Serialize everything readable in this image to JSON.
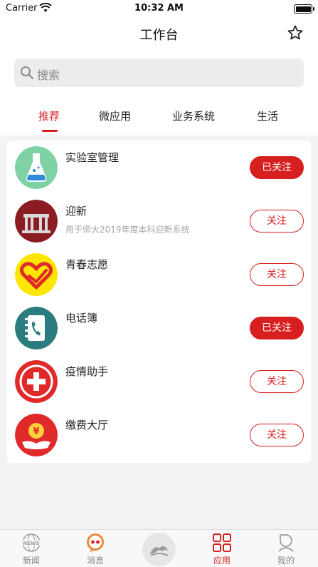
{
  "status_bar": {
    "carrier": "Carrier",
    "time": "10:32 AM"
  },
  "nav": {
    "title": "工作台",
    "star_icon": "star-outline-icon"
  },
  "search": {
    "placeholder": "搜索",
    "icon": "search-icon"
  },
  "tabs": [
    {
      "label": "推荐",
      "active": true
    },
    {
      "label": "微应用",
      "active": false
    },
    {
      "label": "业务系统",
      "active": false
    },
    {
      "label": "生活",
      "active": false
    }
  ],
  "apps": [
    {
      "name": "实验室管理",
      "desc": "",
      "button": "已关注",
      "followed": true,
      "icon": "lab-flask-icon",
      "icon_bg": "#7ed2a4"
    },
    {
      "name": "迎新",
      "desc": "用于师大2019年度本科迎新系统",
      "button": "关注",
      "followed": false,
      "icon": "university-gate-icon",
      "icon_bg": "#8b1c22"
    },
    {
      "name": "青春志愿",
      "desc": "",
      "button": "关注",
      "followed": false,
      "icon": "volunteer-heart-icon",
      "icon_bg": "#ffe600"
    },
    {
      "name": "电话簿",
      "desc": "",
      "button": "已关注",
      "followed": true,
      "icon": "phonebook-icon",
      "icon_bg": "#2a7c7f"
    },
    {
      "name": "疫情助手",
      "desc": "",
      "button": "关注",
      "followed": false,
      "icon": "medical-cross-icon",
      "icon_bg": "#e02a2a"
    },
    {
      "name": "缴费大厅",
      "desc": "",
      "button": "关注",
      "followed": false,
      "icon": "payment-hand-icon",
      "icon_bg": "#e02a2a"
    }
  ],
  "tabbar": [
    {
      "label": "新闻",
      "icon": "news-icon",
      "active": false
    },
    {
      "label": "消息",
      "icon": "message-bubble-icon",
      "active": false
    },
    {
      "label": "",
      "icon": "center-logo-icon",
      "active": false
    },
    {
      "label": "应用",
      "icon": "apps-grid-icon",
      "active": true
    },
    {
      "label": "我的",
      "icon": "profile-icon",
      "active": false
    }
  ],
  "colors": {
    "accent": "#d71f1f",
    "background": "#f3f3f5",
    "muted_text": "#a6a6a6"
  }
}
